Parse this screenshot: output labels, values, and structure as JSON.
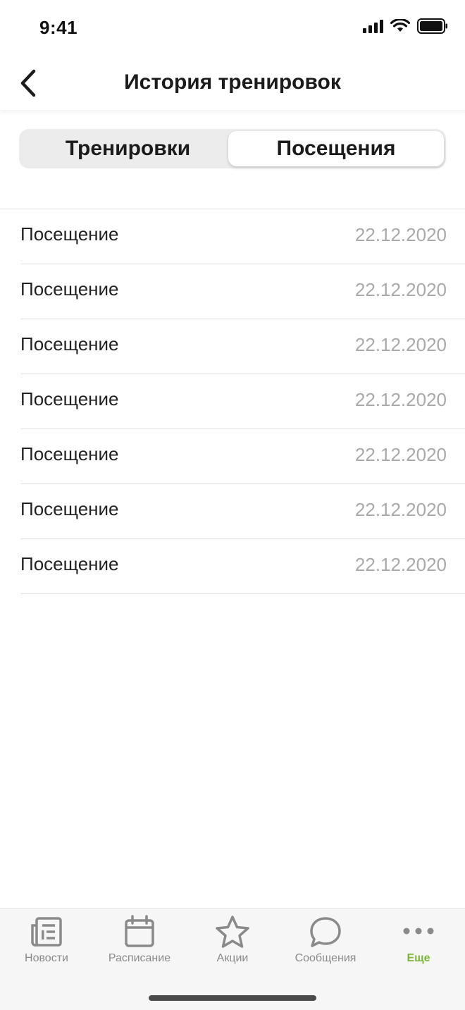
{
  "status_bar": {
    "time": "9:41"
  },
  "header": {
    "title": "История тренировок"
  },
  "segments": [
    {
      "label": "Тренировки",
      "active": false
    },
    {
      "label": "Посещения",
      "active": true
    }
  ],
  "visits": [
    {
      "label": "Посещение",
      "date": "22.12.2020"
    },
    {
      "label": "Посещение",
      "date": "22.12.2020"
    },
    {
      "label": "Посещение",
      "date": "22.12.2020"
    },
    {
      "label": "Посещение",
      "date": "22.12.2020"
    },
    {
      "label": "Посещение",
      "date": "22.12.2020"
    },
    {
      "label": "Посещение",
      "date": "22.12.2020"
    },
    {
      "label": "Посещение",
      "date": "22.12.2020"
    }
  ],
  "tab_bar": {
    "items": [
      {
        "label": "Новости",
        "icon": "news-icon"
      },
      {
        "label": "Расписание",
        "icon": "calendar-icon"
      },
      {
        "label": "Акции",
        "icon": "star-icon"
      },
      {
        "label": "Сообщения",
        "icon": "chat-bubble-icon"
      },
      {
        "label": "Еще",
        "icon": "more-dots-icon",
        "active": true
      }
    ]
  },
  "colors": {
    "accent": "#7cb53a",
    "muted_text": "#a9a9a9",
    "inactive_tab": "#8a8a8a"
  }
}
